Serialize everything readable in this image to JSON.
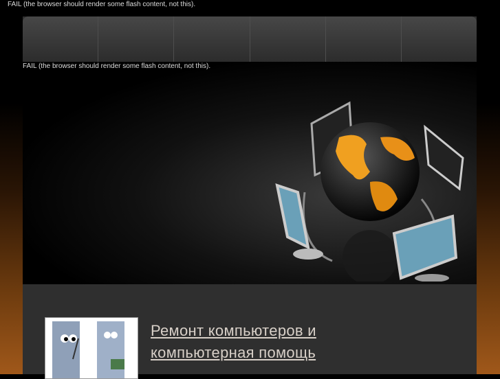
{
  "flash_fallback_top": "FAIL (the browser should render some flash content, not this).",
  "nav": {
    "items": [
      "",
      "",
      "",
      "",
      "",
      ""
    ]
  },
  "hero": {
    "flash_fallback": "FAIL (the browser should render some flash content, not this)."
  },
  "content": {
    "headline_line1": "Ремонт компьютеров и",
    "headline_line2": "компьютерная помощь"
  }
}
